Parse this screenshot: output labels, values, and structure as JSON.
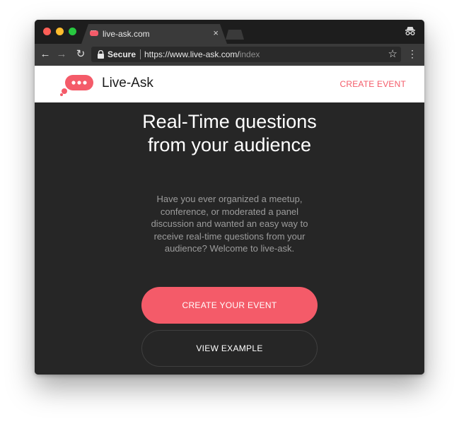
{
  "browser": {
    "tab": {
      "title": "live-ask.com",
      "close_glyph": "×"
    },
    "toolbar": {
      "secure_label": "Secure",
      "url_base": "https://www.live-ask.com/",
      "url_path": "index"
    },
    "icons": [
      "back-arrow-icon",
      "forward-arrow-icon",
      "reload-icon",
      "lock-icon",
      "star-icon",
      "menu-icon",
      "incognito-icon"
    ]
  },
  "header": {
    "brand": "Live-Ask",
    "create_event_link": "CREATE EVENT"
  },
  "hero": {
    "title": "Real-Time questions from your audience",
    "description": "Have you ever organized a meetup, conference, or moderated a panel discussion and wanted an easy way to receive real-time questions from your audience? Welcome to live-ask.",
    "primary_button": "CREATE YOUR EVENT",
    "secondary_button": "VIEW EXAMPLE"
  },
  "colors": {
    "accent": "#f45b69",
    "page_background": "#262626",
    "header_background": "#ffffff"
  }
}
